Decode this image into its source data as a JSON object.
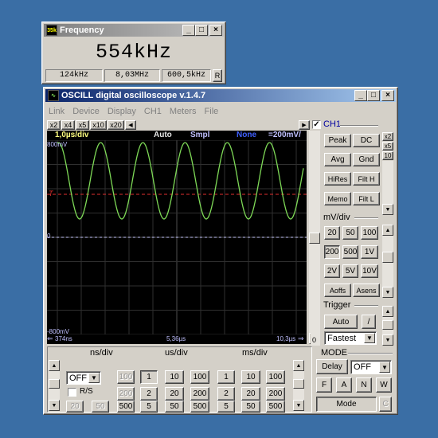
{
  "freq_window": {
    "title": "Frequency",
    "icon": "frequency-app-icon",
    "reading": "554kHz",
    "min": "124kHz",
    "max": "8,03MHz",
    "avg": "600,5kHz",
    "reset_glyph": "R"
  },
  "osc_window": {
    "title": "OSCILL digital oscilloscope  v.1.4.7",
    "menu": [
      "Link",
      "Device",
      "Display",
      "CH1",
      "Meters",
      "File"
    ],
    "zoom_buttons": [
      "x2",
      "x4",
      "x5",
      "x10",
      "x20"
    ],
    "status": {
      "timebase": "1,0µs/div",
      "trigger_mode": "Auto",
      "acq": "Smpl",
      "filter": "None",
      "volts": "=200mV/"
    },
    "y_top": "800mV",
    "y_bottom": "-800mV",
    "y_zero": "0",
    "trig_marker": "T",
    "x_left": "374ns",
    "x_mid": "5,36µs",
    "x_right": "10,3µs",
    "trace_color": "#7ed957",
    "trigger_line_color": "#e03030",
    "ground_line_color": "#c8c8ff",
    "ch1": {
      "label": "CH1",
      "checked": true,
      "buttons": {
        "peak": "Peak",
        "dc": "DC",
        "avg": "Avg",
        "gnd": "Gnd",
        "hires": "HiRes",
        "filth": "Filt H",
        "memo": "Memo",
        "filtl": "Filt L"
      },
      "side_x2": "x2",
      "side_x5": "x5",
      "side_10": "10"
    },
    "mvdiv": {
      "label": "mV/div",
      "buttons": [
        "20",
        "50",
        "100",
        "200",
        "500",
        "1V",
        "2V",
        "5V",
        "10V"
      ],
      "aoffs": "Aoffs",
      "asens": "Asens"
    },
    "trigger": {
      "label": "Trigger",
      "mode": "Auto",
      "slope": "/",
      "speed": "Fastest",
      "level_value": "0"
    },
    "nsdiv": {
      "label": "ns/div",
      "select": "OFF",
      "rs_label": "R/S",
      "buttons": [
        "100",
        "200",
        "20",
        "50",
        "500"
      ]
    },
    "usdiv": {
      "label": "us/div",
      "buttons": [
        "1",
        "10",
        "100",
        "2",
        "20",
        "200",
        "5",
        "50",
        "500"
      ]
    },
    "msdiv": {
      "label": "ms/div",
      "buttons": [
        "1",
        "10",
        "100",
        "2",
        "20",
        "200",
        "5",
        "50",
        "500"
      ]
    },
    "mode": {
      "label": "MODE",
      "delay": "Delay",
      "delay_value": "OFF",
      "f": "F",
      "a": "A",
      "n": "N",
      "w": "W",
      "mode_button": "Mode",
      "c_button": "C"
    }
  }
}
